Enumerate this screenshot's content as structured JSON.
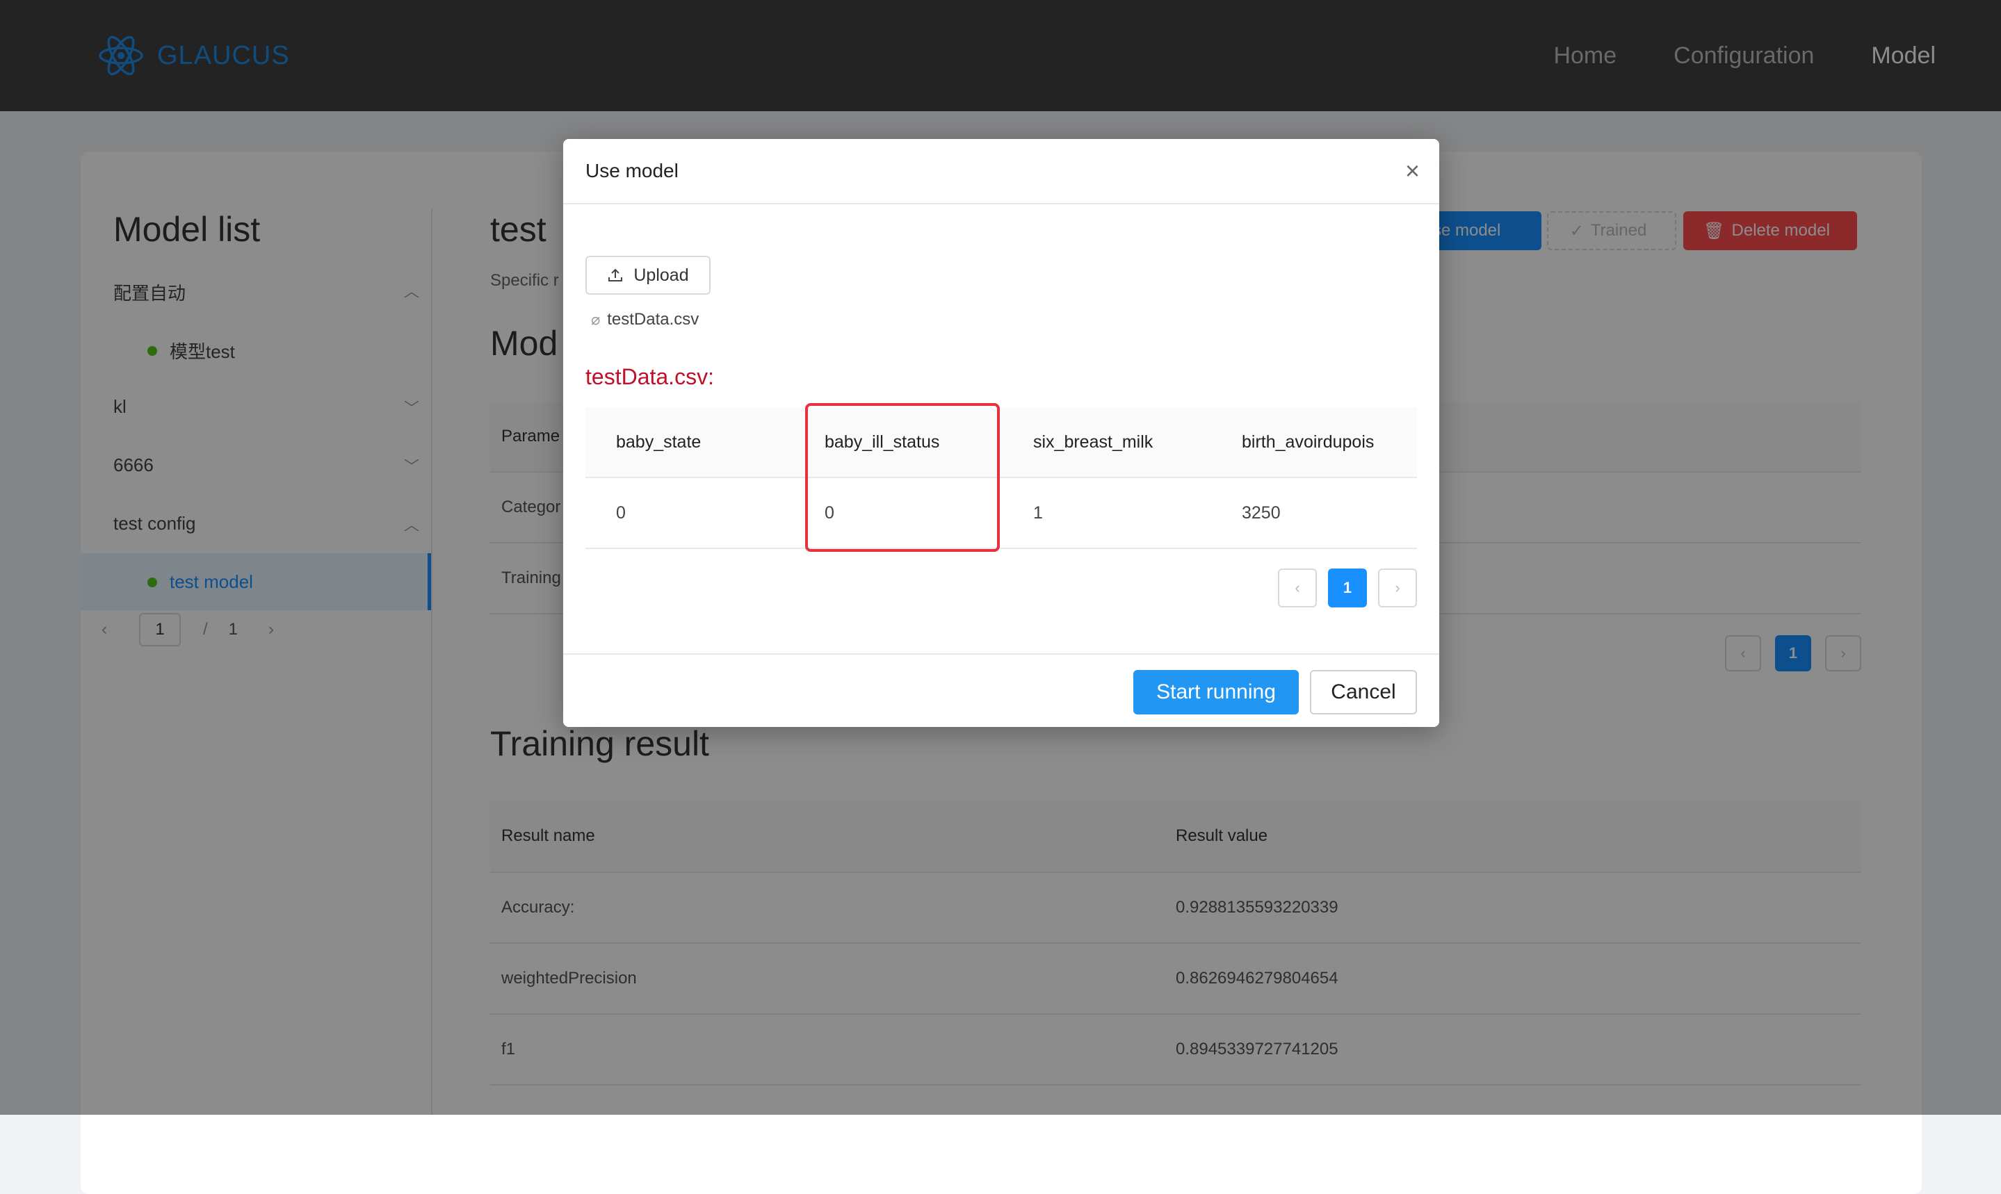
{
  "header": {
    "logo_text": "GLAUCUS",
    "logo_icon": "atom-icon",
    "brand_color": "#1f8ae8",
    "nav": [
      {
        "label": "Home",
        "active": false
      },
      {
        "label": "Configuration",
        "active": false
      },
      {
        "label": "Model",
        "active": true
      }
    ]
  },
  "sidebar": {
    "title": "Model list",
    "groups": [
      {
        "label": "配置自动",
        "expanded": true,
        "items": [
          {
            "label": "模型test",
            "status_color": "#52c41a"
          }
        ]
      },
      {
        "label": "kl",
        "expanded": false,
        "items": []
      },
      {
        "label": "6666",
        "expanded": false,
        "items": []
      },
      {
        "label": "test config",
        "expanded": true,
        "items": [
          {
            "label": "test model",
            "status_color": "#52c41a",
            "selected": true
          }
        ]
      }
    ],
    "pager": {
      "current": "1",
      "separator": "/",
      "total": "1"
    }
  },
  "main": {
    "title": "test",
    "subtitle": "Specific r",
    "model_heading": "Mod",
    "params_table": {
      "header": "Parame",
      "rows": [
        "Categor",
        "Training"
      ]
    },
    "buttons": {
      "use_model": "Use model",
      "trained": "Trained",
      "delete_model": "Delete model"
    },
    "params_pager": {
      "prev": "‹",
      "current": "1",
      "next": "›"
    },
    "training_result": {
      "heading": "Training result",
      "columns": [
        "Result name",
        "Result value"
      ],
      "rows": [
        [
          "Accuracy:",
          "0.9288135593220339"
        ],
        [
          "weightedPrecision",
          "0.8626946279804654"
        ],
        [
          "f1",
          "0.8945339727741205"
        ]
      ]
    }
  },
  "modal": {
    "title": "Use model",
    "close": "×",
    "upload_label": "Upload",
    "file_name": "testData.csv",
    "table_title": "testData.csv:",
    "columns": [
      "baby_state",
      "baby_ill_status",
      "six_breast_milk",
      "birth_avoirdupois"
    ],
    "rows": [
      [
        "0",
        "0",
        "1",
        "3250"
      ]
    ],
    "highlight_color": "#e8303e",
    "pager": {
      "prev": "‹",
      "current": "1",
      "next": "›"
    },
    "start_label": "Start running",
    "cancel_label": "Cancel"
  }
}
